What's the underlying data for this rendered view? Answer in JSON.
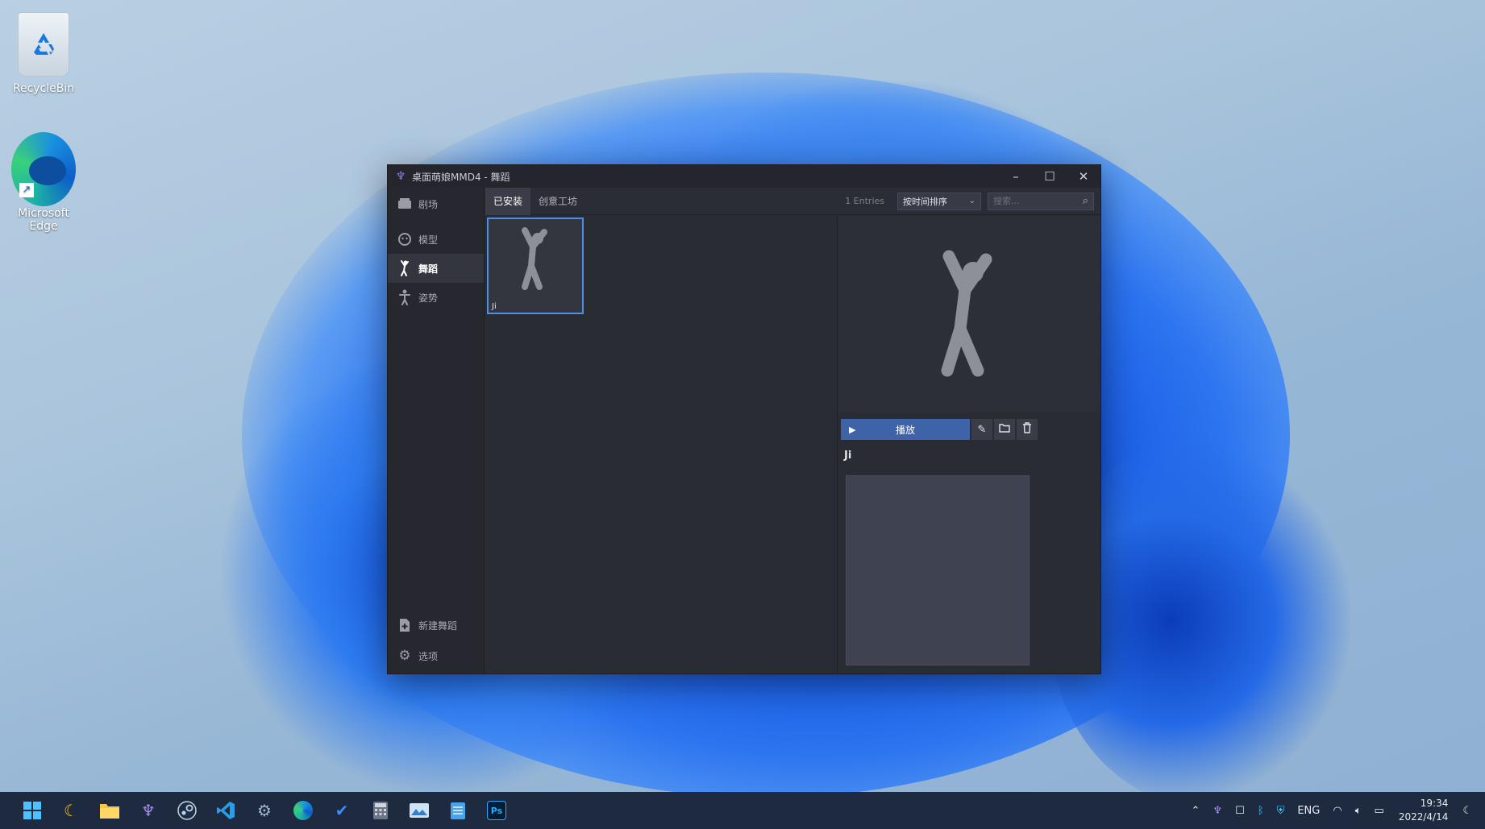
{
  "desktop": {
    "icons": [
      {
        "label": "RecycleBin"
      },
      {
        "label": "Microsoft Edge"
      }
    ]
  },
  "window": {
    "title": "桌面萌娘MMD4 - 舞蹈",
    "sidebar": {
      "items": [
        {
          "label": "剧场",
          "icon": "theater-icon"
        },
        {
          "label": "模型",
          "icon": "model-icon"
        },
        {
          "label": "舞蹈",
          "icon": "dance-icon"
        },
        {
          "label": "姿势",
          "icon": "pose-icon"
        }
      ],
      "bottom": [
        {
          "label": "新建舞蹈",
          "icon": "new-file-icon"
        },
        {
          "label": "选项",
          "icon": "gear-icon"
        }
      ]
    },
    "tabs": [
      {
        "label": "已安装"
      },
      {
        "label": "创意工坊"
      }
    ],
    "entries": "1 Entries",
    "sort": {
      "value": "按时间排序"
    },
    "search": {
      "placeholder": "搜索..."
    },
    "items": [
      {
        "name": "Ji"
      }
    ],
    "detail": {
      "play_label": "播放",
      "name": "Ji"
    }
  },
  "taskbar": {
    "tray": {
      "lang": "ENG",
      "time": "19:34",
      "date": "2022/4/14"
    }
  }
}
